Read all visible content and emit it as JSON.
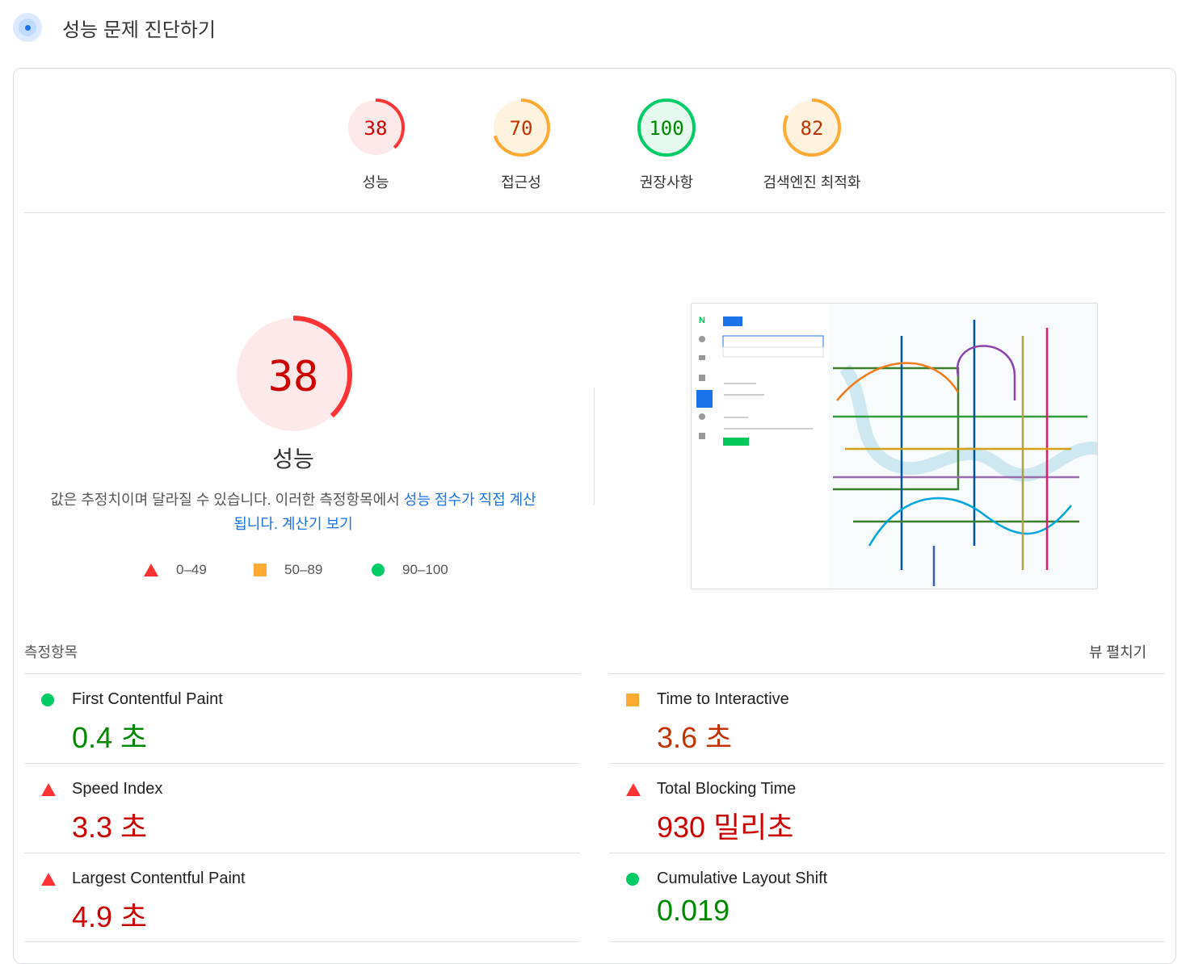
{
  "header": {
    "title": "성능 문제 진단하기"
  },
  "colors": {
    "fail": "#ff3333",
    "average": "#ffaa33",
    "pass": "#00cc66",
    "fail_text": "#cc0000",
    "average_text": "#c33300",
    "pass_text": "#008800"
  },
  "gauges": [
    {
      "score": 38,
      "label": "성능",
      "rating": "fail"
    },
    {
      "score": 70,
      "label": "접근성",
      "rating": "average"
    },
    {
      "score": 100,
      "label": "권장사항",
      "rating": "pass"
    },
    {
      "score": 82,
      "label": "검색엔진 최적화",
      "rating": "average"
    }
  ],
  "performance": {
    "score": "38",
    "label": "성능",
    "desc_pre": "값은 추정치이며 달라질 수 있습니다. 이러한 측정항목에서 ",
    "desc_link": "성능 점수가 직접 계산됩니다.",
    "desc_sep": " ",
    "calc_link": "계산기 보기"
  },
  "legend": [
    {
      "range": "0–49"
    },
    {
      "range": "50–89"
    },
    {
      "range": "90–100"
    }
  ],
  "metrics_header": {
    "title": "측정항목",
    "expand": "뷰 펼치기"
  },
  "metrics": [
    {
      "name": "First Contentful Paint",
      "value": "0.4 초",
      "rating": "pass"
    },
    {
      "name": "Time to Interactive",
      "value": "3.6 초",
      "rating": "average"
    },
    {
      "name": "Speed Index",
      "value": "3.3 초",
      "rating": "fail"
    },
    {
      "name": "Total Blocking Time",
      "value": "930 밀리초",
      "rating": "fail"
    },
    {
      "name": "Largest Contentful Paint",
      "value": "4.9 초",
      "rating": "fail"
    },
    {
      "name": "Cumulative Layout Shift",
      "value": "0.019",
      "rating": "pass"
    }
  ]
}
